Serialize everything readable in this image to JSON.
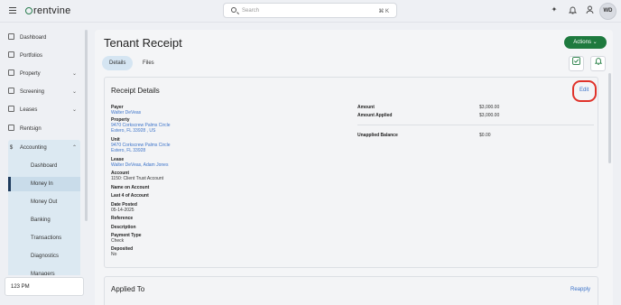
{
  "app": {
    "logo_text": "rentvine"
  },
  "search": {
    "placeholder": "Search",
    "shortcut": "⌘ K"
  },
  "user": {
    "initials": "WD"
  },
  "sidebar": {
    "items": [
      {
        "label": "Dashboard",
        "icon": "dashboard-icon"
      },
      {
        "label": "Portfolios",
        "icon": "folder-icon"
      },
      {
        "label": "Property",
        "icon": "building-icon",
        "expandable": true
      },
      {
        "label": "Screening",
        "icon": "screening-icon",
        "expandable": true
      },
      {
        "label": "Leases",
        "icon": "lease-icon",
        "expandable": true
      },
      {
        "label": "Rentsign",
        "icon": "signature-icon"
      },
      {
        "label": "Accounting",
        "icon": "dollar-icon",
        "expanded": true
      }
    ],
    "accounting_sub": [
      {
        "label": "Dashboard"
      },
      {
        "label": "Money In",
        "active": true
      },
      {
        "label": "Money Out"
      },
      {
        "label": "Banking"
      },
      {
        "label": "Transactions"
      },
      {
        "label": "Diagnostics"
      },
      {
        "label": "Managers"
      }
    ],
    "time_text": "123 PM"
  },
  "page": {
    "title": "Tenant Receipt",
    "actions_label": "Actions",
    "tabs": [
      {
        "label": "Details",
        "active": true
      },
      {
        "label": "Files",
        "active": false
      }
    ]
  },
  "receipt": {
    "title": "Receipt Details",
    "edit_label": "Edit",
    "payer_label": "Payer",
    "payer": "Walter DeVeas",
    "property_label": "Property",
    "property_line1": "9470 Corkscrew Palms Circle",
    "property_line2": "Estero, FL 33928 , US",
    "unit_label": "Unit",
    "unit_line1": "9470 Corkscrew Palms Circle",
    "unit_line2": "Estero, FL 33928",
    "lease_label": "Lease",
    "lease": "Walter DeVeas, Adam Jones",
    "account_label": "Account",
    "account": "1150: Client Trust Account",
    "name_on_account_label": "Name on Account",
    "last4_label": "Last 4 of Account",
    "date_posted_label": "Date Posted",
    "date_posted": "05-14-2025",
    "reference_label": "Reference",
    "description_label": "Description",
    "payment_type_label": "Payment Type",
    "payment_type": "Check",
    "deposited_label": "Deposited",
    "deposited": "No",
    "amount_label": "Amount",
    "amount": "$3,000.00",
    "amount_applied_label": "Amount Applied",
    "amount_applied": "$3,000.00",
    "unapplied_label": "Unapplied Balance",
    "unapplied": "$0.00"
  },
  "applied": {
    "title": "Applied To",
    "reapply_label": "Reapply"
  },
  "colors": {
    "accent_green": "#1e7a3e",
    "link_blue": "#3c73c9",
    "highlight_red": "#e0332b",
    "sidebar_active": "#c9dcea"
  }
}
